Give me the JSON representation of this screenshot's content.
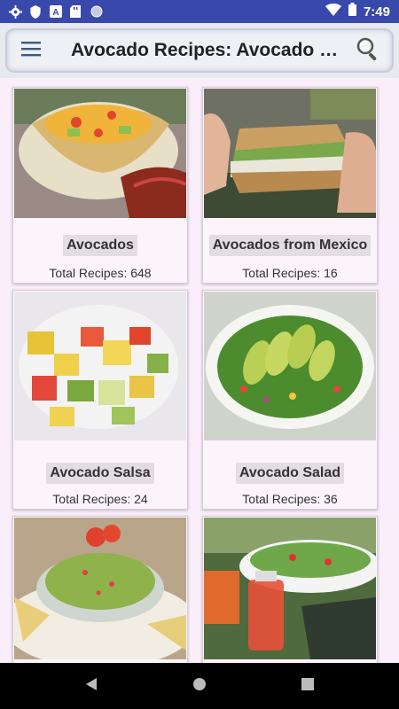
{
  "status_bar": {
    "time": "7:49",
    "icons": [
      "gear-icon",
      "shield-icon",
      "a-box-icon",
      "sd-card-icon",
      "circle-icon",
      "wifi-icon",
      "battery-icon"
    ]
  },
  "app_bar": {
    "title": "Avocado Recipes: Avocado s…",
    "menu_icon": "hamburger-menu-icon",
    "search_icon": "search-icon"
  },
  "cards": [
    {
      "title": "Avocados",
      "count": "Total Recipes: 648",
      "image": "taco-salad-bowl"
    },
    {
      "title": "Avocados from Mexico",
      "count": "Total Recipes: 16",
      "image": "avocado-sandwich"
    },
    {
      "title": "Avocado Salsa",
      "count": "Total Recipes: 24",
      "image": "mango-avocado-salsa"
    },
    {
      "title": "Avocado Salad",
      "count": "Total Recipes: 36",
      "image": "avocado-green-salad"
    },
    {
      "title": "",
      "count": "",
      "image": "guacamole-chips"
    },
    {
      "title": "",
      "count": "",
      "image": "salad-bowl-outdoor"
    }
  ],
  "nav_bar": {
    "back_icon": "back-triangle-icon",
    "home_icon": "home-circle-icon",
    "recents_icon": "recents-square-icon"
  },
  "colors": {
    "status_bar": "#3949ab",
    "background": "#fbeefb",
    "app_bar": "#e8e8f0"
  }
}
